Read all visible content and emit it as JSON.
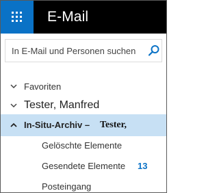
{
  "header": {
    "app_title": "E-Mail",
    "waffle_icon": "app-launcher-icon"
  },
  "search": {
    "placeholder": "In E-Mail und Personen suchen",
    "icon": "search-icon"
  },
  "nav": {
    "favorites_label": "Favoriten",
    "account_label": "Tester, Manfred",
    "archive_label": "In-Situ-Archiv –",
    "archive_owner": "Tester,",
    "folders": [
      {
        "label": "Gelöschte Elemente",
        "count": ""
      },
      {
        "label": "Gesendete Elemente",
        "count": "13"
      },
      {
        "label": "Posteingang",
        "count": ""
      }
    ]
  },
  "colors": {
    "brand": "#0a72c6",
    "header_bg": "#000000",
    "selected_bg": "#c7e0f4",
    "unread_count": "#0a72c6"
  }
}
